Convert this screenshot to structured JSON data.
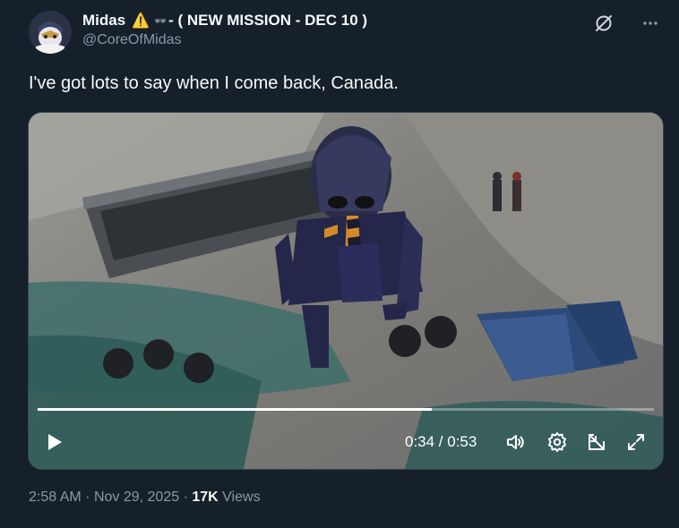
{
  "author": {
    "name": "Midas",
    "warning_glyph": "⚠️",
    "glasses_glyph": "🕶",
    "name_suffix": "- ( NEW MISSION - DEC 10 )",
    "handle": "@CoreOfMidas"
  },
  "tweet": {
    "text": "I've got lots to say when I come back, Canada."
  },
  "video": {
    "time_display": "0:34 / 0:53",
    "progress_fraction": 0.64
  },
  "meta": {
    "time": "2:58 AM",
    "separator": "·",
    "date": "Nov 29, 2025",
    "views_count": "17K",
    "views_label": "Views"
  },
  "icons": {
    "header": [
      "grok-icon",
      "more-icon"
    ],
    "video_controls": [
      "play-icon",
      "volume-icon",
      "settings-icon",
      "picture-in-picture-icon",
      "fullscreen-icon"
    ]
  },
  "colors": {
    "background": "#15202b",
    "secondary_text": "#8b98a5",
    "primary_text": "#f7f9f9"
  }
}
